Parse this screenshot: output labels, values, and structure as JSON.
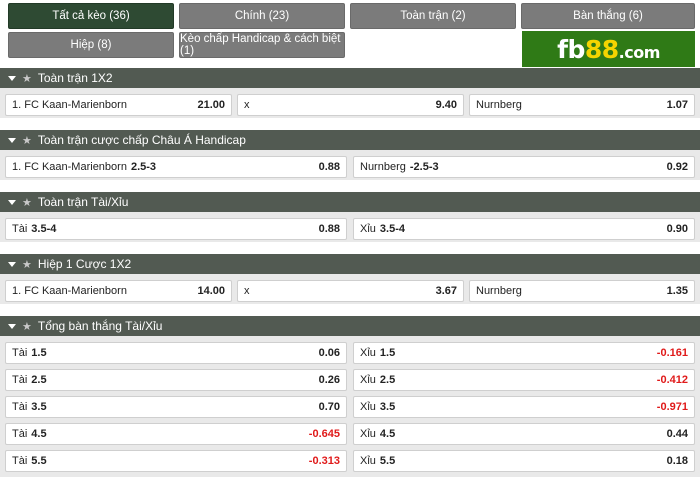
{
  "tabs": [
    {
      "label": "Tất cả kèo (36)",
      "active": true
    },
    {
      "label": "Chính (23)",
      "active": false
    },
    {
      "label": "Toàn trận (2)",
      "active": false
    },
    {
      "label": "Bàn thắng (6)",
      "active": false
    },
    {
      "label": "Hiệp (8)",
      "active": false
    },
    {
      "label": "Kèo chấp Handicap & cách biệt (1)",
      "active": false
    }
  ],
  "logo": {
    "main": "fb",
    "accent": "88",
    "domain": ".com"
  },
  "sections": [
    {
      "title": "Toàn trận 1X2",
      "rows": [
        {
          "cells": [
            {
              "label": "1. FC Kaan-Marienborn",
              "line": "",
              "odd": "21.00"
            },
            {
              "label": "x",
              "line": "",
              "odd": "9.40"
            },
            {
              "label": "Nurnberg",
              "line": "",
              "odd": "1.07"
            }
          ]
        }
      ]
    },
    {
      "title": "Toàn trận cược chấp Châu Á Handicap",
      "rows": [
        {
          "cells": [
            {
              "label": "1. FC Kaan-Marienborn",
              "line": "2.5-3",
              "odd": "0.88"
            },
            {
              "label": "Nurnberg",
              "line": "-2.5-3",
              "odd": "0.92"
            }
          ]
        }
      ]
    },
    {
      "title": "Toàn trận Tài/Xỉu",
      "rows": [
        {
          "cells": [
            {
              "label": "Tài",
              "line": "3.5-4",
              "odd": "0.88"
            },
            {
              "label": "Xỉu",
              "line": "3.5-4",
              "odd": "0.90"
            }
          ]
        }
      ]
    },
    {
      "title": "Hiệp 1 Cược 1X2",
      "rows": [
        {
          "cells": [
            {
              "label": "1. FC Kaan-Marienborn",
              "line": "",
              "odd": "14.00"
            },
            {
              "label": "x",
              "line": "",
              "odd": "3.67"
            },
            {
              "label": "Nurnberg",
              "line": "",
              "odd": "1.35"
            }
          ]
        }
      ]
    },
    {
      "title": "Tổng bàn thắng Tài/Xỉu",
      "rows": [
        {
          "cells": [
            {
              "label": "Tài",
              "line": "1.5",
              "odd": "0.06"
            },
            {
              "label": "Xỉu",
              "line": "1.5",
              "odd": "-0.161"
            }
          ]
        },
        {
          "cells": [
            {
              "label": "Tài",
              "line": "2.5",
              "odd": "0.26"
            },
            {
              "label": "Xỉu",
              "line": "2.5",
              "odd": "-0.412"
            }
          ]
        },
        {
          "cells": [
            {
              "label": "Tài",
              "line": "3.5",
              "odd": "0.70"
            },
            {
              "label": "Xỉu",
              "line": "3.5",
              "odd": "-0.971"
            }
          ]
        },
        {
          "cells": [
            {
              "label": "Tài",
              "line": "4.5",
              "odd": "-0.645"
            },
            {
              "label": "Xỉu",
              "line": "4.5",
              "odd": "0.44"
            }
          ]
        },
        {
          "cells": [
            {
              "label": "Tài",
              "line": "5.5",
              "odd": "-0.313"
            },
            {
              "label": "Xỉu",
              "line": "5.5",
              "odd": "0.18"
            }
          ]
        }
      ]
    }
  ],
  "colors": {
    "active_tab": "#2e4a33",
    "tab": "#7b7b7b",
    "header": "#525a52",
    "negative": "#e01a1a",
    "logo_bg": "#2f7a16",
    "logo_accent": "#f4d400"
  }
}
